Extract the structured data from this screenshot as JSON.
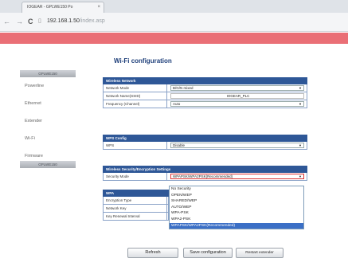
{
  "browser": {
    "tab_title": "IOGEAR - GPLWE150 Po",
    "tab_close": "×",
    "back": "←",
    "forward": "→",
    "reload": "C",
    "url_host": "192.168.1.50",
    "url_path": "/index.asp"
  },
  "sidebar": {
    "top_band": "GPLWE150",
    "items": [
      "Powerline",
      "Ethernet",
      "Extender",
      "Wi-Fi",
      "Firmware"
    ],
    "bottom_band": "GPLWE150"
  },
  "page_title": "Wi-Fi configuration",
  "wireless_network": {
    "header": "Wireless Network",
    "rows": [
      {
        "label": "Network Mode",
        "value": "B/G/N mixed"
      },
      {
        "label": "Network Name(SSID)",
        "value": "IOGEAR_PLC"
      },
      {
        "label": "Frequency (Channel)",
        "value": "Auto"
      }
    ]
  },
  "wps_config": {
    "header": "WPS Config",
    "rows": [
      {
        "label": "WPS",
        "value": "Disable"
      }
    ]
  },
  "security": {
    "header": "Wireless Security/Encryption Settings",
    "security_mode_label": "Security Mode",
    "security_mode_value": "WPAPSK/WPA2PSK(Recommended)"
  },
  "wpa": {
    "header": "WPA",
    "rows": [
      {
        "label": "Encryption Type"
      },
      {
        "label": "Network Key"
      },
      {
        "label": "Key Renewal Interval"
      }
    ]
  },
  "dropdown_options": [
    "No Security",
    "OPEN/WEP",
    "SHARED/WEP",
    "AUTO/WEP",
    "WPA-PSK",
    "WPA2-PSK",
    "WPAPSK/WPA2PSK(Recommended)"
  ],
  "dropdown_selected_index": 6,
  "buttons": {
    "refresh": "Refresh",
    "save": "Save configuration",
    "restart": "Restart extender"
  }
}
